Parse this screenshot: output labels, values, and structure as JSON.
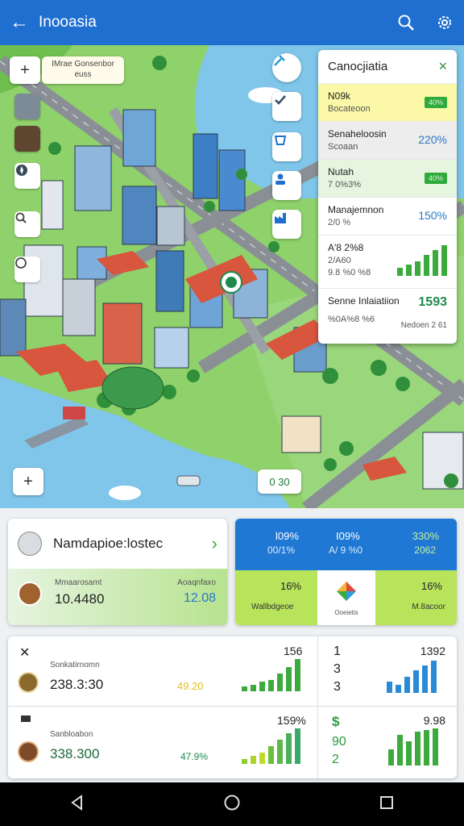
{
  "appbar": {
    "back_icon": "arrow-back-icon",
    "title": "Inooasia",
    "search_icon": "search-icon",
    "settings_icon": "gear-icon"
  },
  "map": {
    "tip_text_1": "IMrae Gonsenbor",
    "tip_text_2": "euss",
    "zoom_button": "+",
    "bottom_chip": "0 30",
    "bottom_plus": "+"
  },
  "panel": {
    "title": "Canocjiatia",
    "close": "×",
    "rows": [
      {
        "title": "N09k",
        "sub": "Bocateoon",
        "value": "40%",
        "kind": "badge",
        "style": "yellow"
      },
      {
        "title": "Senaheloosin",
        "sub": "Scoaan",
        "value": "220%",
        "kind": "text",
        "style": "grey"
      },
      {
        "title": "Nutah",
        "sub": "7 0%3%",
        "value": "40%",
        "kind": "badge",
        "style": "green"
      },
      {
        "title": "Manajemnon",
        "sub": "2/0 %",
        "value": "150%",
        "kind": "text",
        "style": ""
      },
      {
        "title": "A'8 2%8",
        "sub": "2/A60",
        "value2": "9.8 %0 %8",
        "kind": "chart",
        "style": ""
      },
      {
        "title": "Senne Inlaiatiion",
        "sub": "%0A%8 %6",
        "value": "1593",
        "value_sub": "Nedoen 2 61",
        "kind": "text",
        "style": ""
      }
    ]
  },
  "card1": {
    "title": "Namdapioe:lostec",
    "chevron": "›",
    "row_label": "Mmaarosamt",
    "row_value": "10.4480",
    "row_right_label": "Aoaqnfaxo",
    "row_right_value": "12.08"
  },
  "card2": {
    "top_a": "l09%",
    "top_a_sub": "00/1%",
    "top_b": "I09%",
    "top_b_sub": "A/ 9 %0",
    "top_c": "330%",
    "top_c_sub": "2062",
    "bottom_a": "16%",
    "bottom_a_sub": "Wallbdgeoe",
    "bottom_c": "16%",
    "bottom_c_sub": "M.8acoor",
    "logo_caption": "Ooeietis"
  },
  "card3": {
    "row1": {
      "icon": "hammer-icon",
      "label": "Sonkatirnomn",
      "value": "238.3:30",
      "mid": "49.20",
      "right_value": "156"
    },
    "row2": {
      "icon": "minus-icon",
      "label": "Sanbloabon",
      "value": "338.300",
      "mid": "47.9%",
      "right_value": "159%"
    },
    "col2": {
      "a": "1",
      "b": "3",
      "c": "3",
      "right_a": "1392",
      "d": "$",
      "e": "90",
      "f": "2",
      "right_b": "9.98"
    }
  }
}
